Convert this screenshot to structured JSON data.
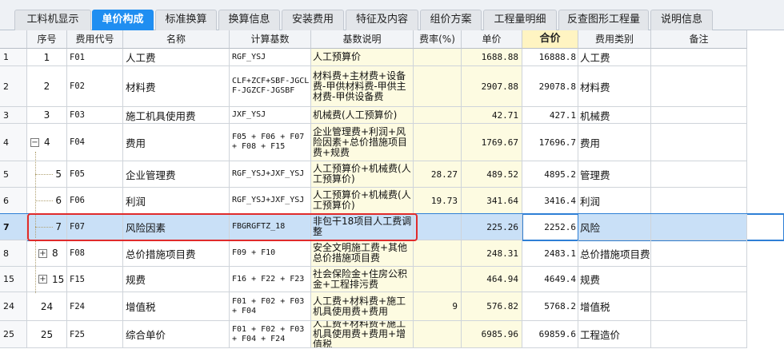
{
  "tabs": [
    {
      "label": "工料机显示",
      "active": false
    },
    {
      "label": "单价构成",
      "active": true
    },
    {
      "label": "标准换算",
      "active": false
    },
    {
      "label": "换算信息",
      "active": false
    },
    {
      "label": "安装费用",
      "active": false
    },
    {
      "label": "特征及内容",
      "active": false
    },
    {
      "label": "组价方案",
      "active": false
    },
    {
      "label": "工程量明细",
      "active": false
    },
    {
      "label": "反查图形工程量",
      "active": false
    },
    {
      "label": "说明信息",
      "active": false
    }
  ],
  "columns": {
    "seq": "序号",
    "code": "费用代号",
    "name": "名称",
    "base": "计算基数",
    "desc": "基数说明",
    "rate": "费率(%)",
    "unit": "单价",
    "total": "合价",
    "type": "费用类别",
    "note": "备注"
  },
  "rows": [
    {
      "idx": "1",
      "seq": "1",
      "code": "F01",
      "name": "人工费",
      "base": "RGF_YSJ",
      "desc": "人工预算价",
      "rate": "",
      "unit": "1688.88",
      "total": "16888.8",
      "type": "人工费",
      "note": ""
    },
    {
      "idx": "2",
      "seq": "2",
      "code": "F02",
      "name": "材料费",
      "base": "CLF+ZCF+SBF-JGCLF-JGZCF-JGSBF",
      "desc": "材料费+主材费+设备费-甲供材料费-甲供主材费-甲供设备费",
      "rate": "",
      "unit": "2907.88",
      "total": "29078.8",
      "type": "材料费",
      "note": ""
    },
    {
      "idx": "3",
      "seq": "3",
      "code": "F03",
      "name": "施工机具使用费",
      "base": "JXF_YSJ",
      "desc": "机械费(人工预算价)",
      "rate": "",
      "unit": "42.71",
      "total": "427.1",
      "type": "机械费",
      "note": ""
    },
    {
      "idx": "4",
      "seq": "4",
      "code": "F04",
      "name": "费用",
      "base": "F05 + F06 + F07 + F08 + F15",
      "desc": "企业管理费+利润+风险因素+总价措施项目费+规费",
      "rate": "",
      "unit": "1769.67",
      "total": "17696.7",
      "type": "费用",
      "note": "",
      "toggle": "−"
    },
    {
      "idx": "5",
      "seq": "5",
      "code": "F05",
      "name": "企业管理费",
      "base": "RGF_YSJ+JXF_YSJ",
      "desc": "人工预算价+机械费(人工预算价)",
      "rate": "28.27",
      "unit": "489.52",
      "total": "4895.2",
      "type": "管理费",
      "note": ""
    },
    {
      "idx": "6",
      "seq": "6",
      "code": "F06",
      "name": "利润",
      "base": "RGF_YSJ+JXF_YSJ",
      "desc": "人工预算价+机械费(人工预算价)",
      "rate": "19.73",
      "unit": "341.64",
      "total": "3416.4",
      "type": "利润",
      "note": ""
    },
    {
      "idx": "7",
      "seq": "7",
      "code": "F07",
      "name": "风险因素",
      "base": "FBGRGFTZ_18",
      "desc": "非包干18项目人工费调整",
      "rate": "",
      "unit": "225.26",
      "total": "2252.6",
      "type": "风险",
      "note": ""
    },
    {
      "idx": "8",
      "seq": "8",
      "code": "F08",
      "name": "总价措施项目费",
      "base": "F09 + F10",
      "desc": "安全文明施工费+其他总价措施项目费",
      "rate": "",
      "unit": "248.31",
      "total": "2483.1",
      "type": "总价措施项目费",
      "note": "",
      "toggle": "+"
    },
    {
      "idx": "15",
      "seq": "15",
      "code": "F15",
      "name": "规费",
      "base": "F16 + F22 + F23",
      "desc": "社会保险金+住房公积金+工程排污费",
      "rate": "",
      "unit": "464.94",
      "total": "4649.4",
      "type": "规费",
      "note": "",
      "toggle": "+"
    },
    {
      "idx": "24",
      "seq": "24",
      "code": "F24",
      "name": "增值税",
      "base": "F01 + F02 + F03 + F04",
      "desc": "人工费+材料费+施工机具使用费+费用",
      "rate": "9",
      "unit": "576.82",
      "total": "5768.2",
      "type": "增值税",
      "note": ""
    },
    {
      "idx": "25",
      "seq": "25",
      "code": "F25",
      "name": "综合单价",
      "base": "F01 + F02 + F03 + F04 + F24",
      "desc": "人工费+材料费+施工机具使用费+费用+增值税",
      "rate": "",
      "unit": "6985.96",
      "total": "69859.6",
      "type": "工程造价",
      "note": ""
    }
  ]
}
